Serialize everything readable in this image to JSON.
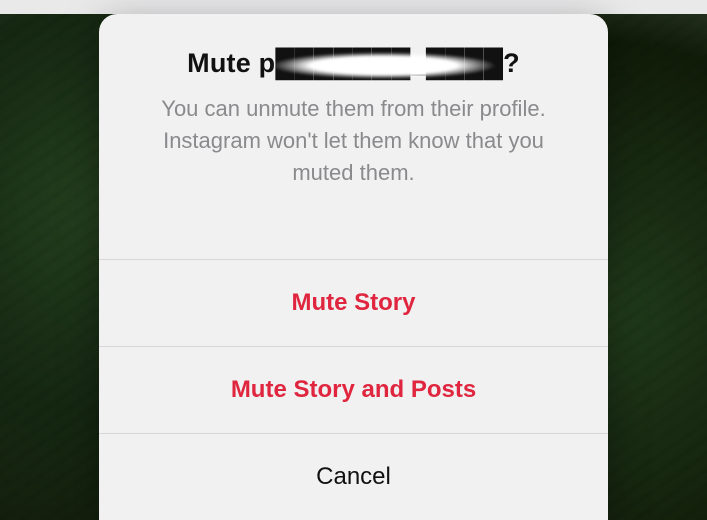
{
  "dialog": {
    "title": "Mute p███████_████?",
    "subtitle": "You can unmute them from their profile. Instagram won't let them know that you muted them.",
    "actions": {
      "mute_story": "Mute Story",
      "mute_story_posts": "Mute Story and Posts",
      "cancel": "Cancel"
    }
  },
  "colors": {
    "destructive": "#e0263f",
    "sheet_bg": "#f1f1f2",
    "divider": "#d7d7da",
    "muted_text": "#8a8a8d"
  }
}
